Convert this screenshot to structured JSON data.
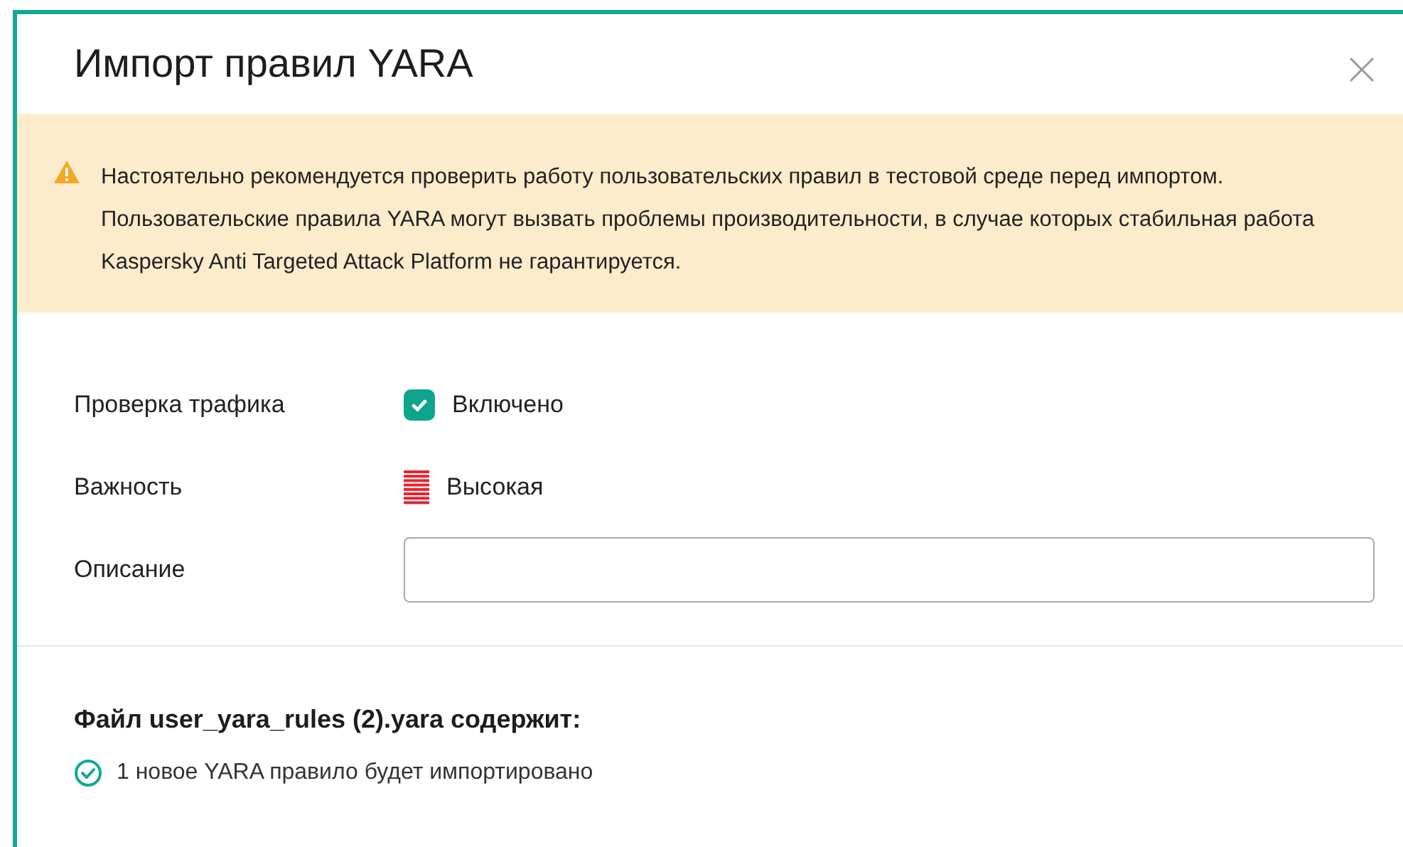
{
  "dialog": {
    "title": "Импорт правил YARA"
  },
  "warning": {
    "text": "Настоятельно рекомендуется проверить работу пользовательских правил в тестовой среде перед импортом. Пользовательские правила YARA могут вызвать проблемы производительности, в случае которых стабильная работа Kaspersky Anti Targeted Attack Platform не гарантируется."
  },
  "form": [
    {
      "kind": "checkbox",
      "label": "Проверка трафика",
      "value": "Включено",
      "checked": true
    },
    {
      "kind": "severity",
      "label": "Важность",
      "value": "Высокая",
      "color": "#e8232f"
    },
    {
      "kind": "input",
      "label": "Описание"
    }
  ],
  "file_summary": {
    "heading": "Файл user_yara_rules (2).yara содержит:",
    "items": [
      "1 новое YARA правило будет импортировано"
    ]
  }
}
